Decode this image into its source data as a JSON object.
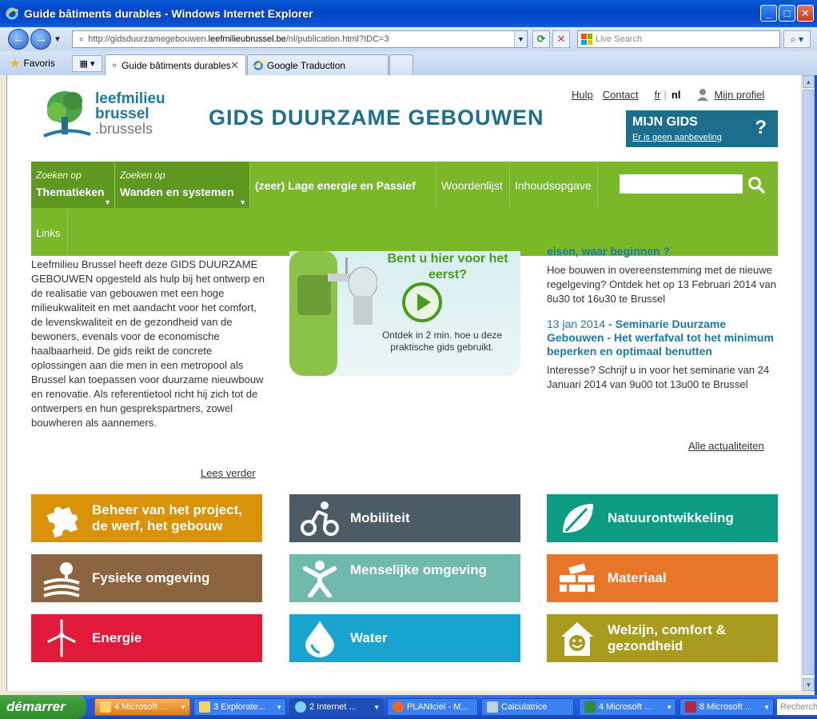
{
  "window": {
    "title": "Guide bâtiments durables - Windows Internet Explorer",
    "minimize": "_",
    "maximize": "□",
    "close": "✕"
  },
  "address": {
    "url_prefix": "http://gidsduurzamegebouwen.",
    "url_host": "leefmilieubrussel.be",
    "url_path": "/nl/publication.html?IDC=3",
    "search_placeholder": "Live Search"
  },
  "favorites_label": "Favoris",
  "tabs": [
    {
      "label": "Guide bâtiments durables",
      "active": true
    },
    {
      "label": "Google Traduction",
      "active": false
    }
  ],
  "site": {
    "logo": {
      "line1": "leefmilieu",
      "line2": "brussel",
      "line3": ".brussels"
    },
    "title": "GIDS DUURZAME GEBOUWEN",
    "toplinks": {
      "help": "Hulp",
      "contact": "Contact",
      "lang_fr": "fr",
      "lang_nl": "nl",
      "profile": "Mijn profiel"
    },
    "mijngids": {
      "title": "MIJN GIDS",
      "subtitle": "Er is geen aanbeveling",
      "help": "?"
    },
    "nav": {
      "item1": {
        "small": "Zoeken op",
        "big": "Thematieken"
      },
      "item2": {
        "small": "Zoeken op",
        "big": "Wanden en systemen"
      },
      "item3": "(zeer) Lage energie en Passief",
      "item4": "Woordenlijst",
      "item5": "Inhoudsopgave",
      "item6": "Links"
    },
    "intro": "Leefmilieu Brussel heeft deze GIDS DUURZAME GEBOUWEN opgesteld als hulp bij het ontwerp en de realisatie van gebouwen met een hoge milieukwaliteit en met aandacht voor het comfort, de levenskwaliteit en de gezondheid van de bewoners, evenals voor de economische haalbaarheid. De gids reikt de concrete oplossingen aan die men in een metropool als Brussel kan toepassen voor duurzame nieuwbouw en renovatie. Als referentietool richt hij zich tot de ontwerpers en hun gesprekspartners, zowel bouwheren als aannemers.",
    "lees_verder": "Lees verder",
    "video": {
      "headline": "Bent u hier voor het eerst?",
      "caption": "Ontdek in 2 min. hoe u deze praktische gids gebruikt."
    },
    "news": {
      "item1_title_tail": "eisen, waar beginnen ?",
      "item1_body": "Hoe bouwen in overeenstemming met de nieuwe regelgeving? Ontdek het op 13 Februari 2014 van 8u30 tot 16u30 te Brussel",
      "item2_date": "13 jan 2014",
      "item2_sep": " - ",
      "item2_title": "Seminarie Duurzame Gebouwen - Het werfafval tot het minimum beperken en optimaal benutten",
      "item2_body": "Interesse? Schrijf u in voor het seminarie van 24 Januari 2014 van 9u00 tot 13u00 te Brussel",
      "all": "Alle actualiteiten"
    },
    "tiles": [
      {
        "label": "Beheer van het project, de werf, het gebouw",
        "color": "#d8930a",
        "icon": "puzzle-icon"
      },
      {
        "label": "Mobiliteit",
        "color": "#4b5c66",
        "icon": "cyclist-icon"
      },
      {
        "label": "Natuurontwikkeling",
        "color": "#0d9b84",
        "icon": "leaf-icon"
      },
      {
        "label": "Fysieke omgeving",
        "color": "#8c6440",
        "icon": "landscape-icon"
      },
      {
        "label": "Menselijke omgeving",
        "color": "#72b9ad",
        "icon": "person-icon"
      },
      {
        "label": "Materiaal",
        "color": "#e8762a",
        "icon": "bricks-icon"
      },
      {
        "label": "Energie",
        "color": "#e1193b",
        "icon": "wind-turbine-icon"
      },
      {
        "label": "Water",
        "color": "#18a4cf",
        "icon": "water-drop-icon"
      },
      {
        "label": "Welzijn, comfort & gezondheid",
        "color": "#a99a20",
        "icon": "house-smile-icon"
      }
    ]
  },
  "taskbar": {
    "start": "démarrer",
    "items": [
      "4 Microsoft ...",
      "3 Explorate...",
      "2 Internet ...",
      "PLANIciel - M...",
      "Calculatrice",
      "4 Microsoft ...",
      "8 Microsoft ..."
    ],
    "search": "Recherch"
  }
}
